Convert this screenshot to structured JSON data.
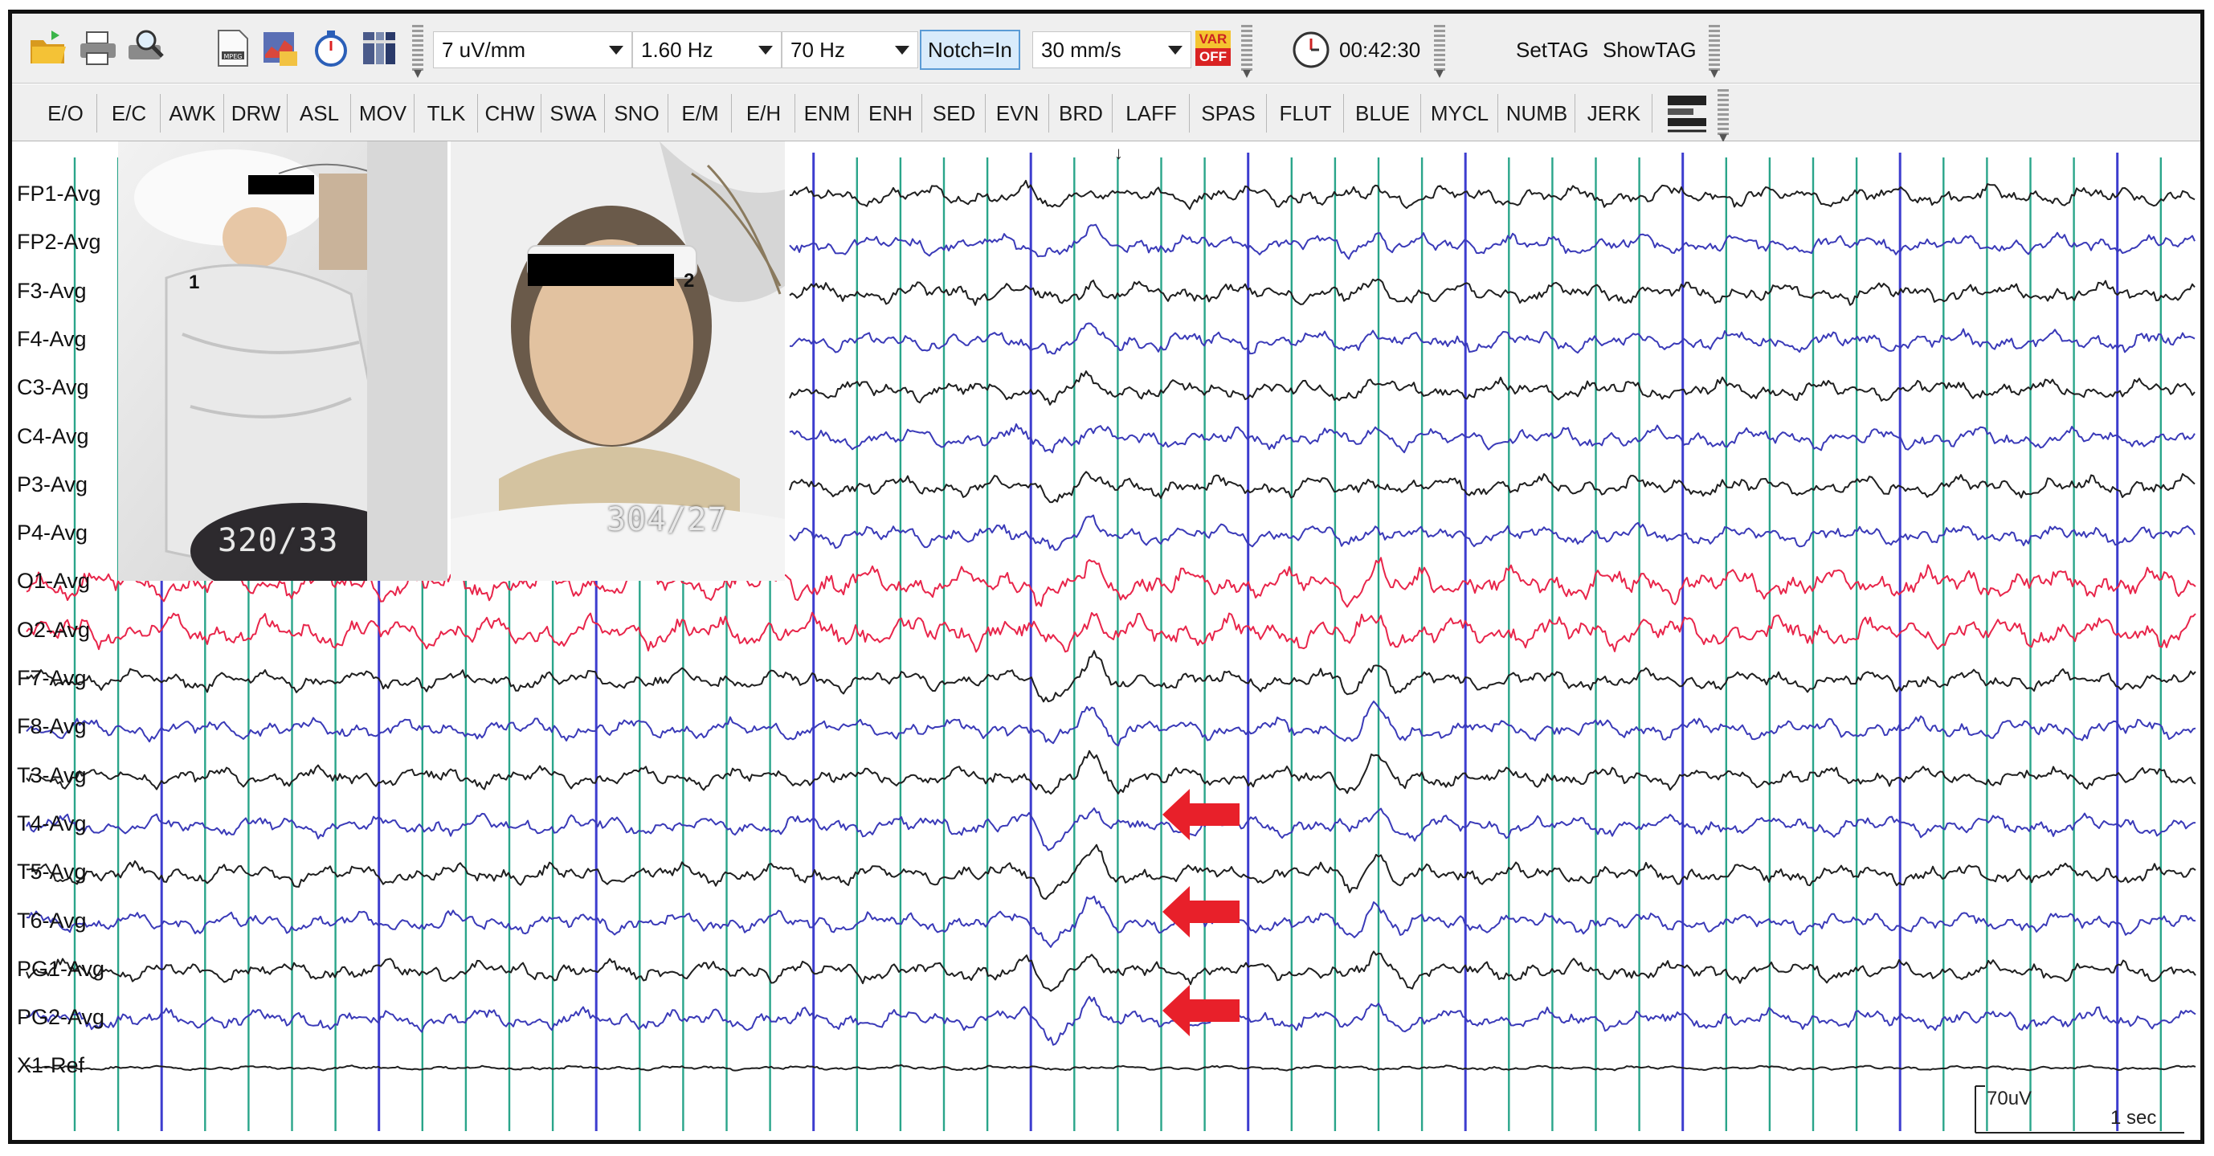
{
  "toolbar1": {
    "icons": [
      "open-folder-icon",
      "print-icon",
      "print-preview-icon",
      "mpeg-export-icon",
      "chart-export-icon",
      "stopwatch-icon",
      "montage-icon"
    ],
    "sensitivity": "7 uV/mm",
    "low_filter": "1.60 Hz",
    "high_filter": "70 Hz",
    "notch": "Notch=In",
    "speed": "30 mm/s",
    "var_badge_top": "VAR",
    "var_badge_bottom": "OFF",
    "timer_value": "00:42:30",
    "settag_label": "SetTAG",
    "showtag_label": "ShowTAG"
  },
  "event_buttons": [
    "E/O",
    "E/C",
    "AWK",
    "DRW",
    "ASL",
    "MOV",
    "TLK",
    "CHW",
    "SWA",
    "SNO",
    "E/M",
    "E/H",
    "ENM",
    "ENH",
    "SED",
    "EVN",
    "BRD",
    "LAFF",
    "SPAS",
    "FLUT",
    "BLUE",
    "MYCL",
    "NUMB",
    "JERK"
  ],
  "channels": [
    "FP1-Avg",
    "FP2-Avg",
    "F3-Avg",
    "F4-Avg",
    "C3-Avg",
    "C4-Avg",
    "P3-Avg",
    "P4-Avg",
    "O1-Avg",
    "O2-Avg",
    "F7-Avg",
    "F8-Avg",
    "T3-Avg",
    "T4-Avg",
    "T5-Avg",
    "T6-Avg",
    "PG1-Avg",
    "PG2-Avg",
    "X1-Ref"
  ],
  "channel_colors": [
    "#1f1f1f",
    "#3a3ab8",
    "#1f1f1f",
    "#3a3ab8",
    "#1f1f1f",
    "#3a3ab8",
    "#1f1f1f",
    "#3a3ab8",
    "#e8254a",
    "#e8254a",
    "#1f1f1f",
    "#3a3ab8",
    "#1f1f1f",
    "#3a3ab8",
    "#1f1f1f",
    "#3a3ab8",
    "#1f1f1f",
    "#3a3ab8",
    "#1f1f1f"
  ],
  "video": {
    "left_label": "1",
    "left_frame": "320/33",
    "right_label": "2",
    "right_frame": "304/27"
  },
  "scale": {
    "amplitude": "70uV",
    "time": "1 sec"
  },
  "marker_symbol": "↓",
  "colors": {
    "grid_minor": "#2aa58a",
    "grid_major": "#3d3dcf",
    "arrow": "#e8202a"
  }
}
